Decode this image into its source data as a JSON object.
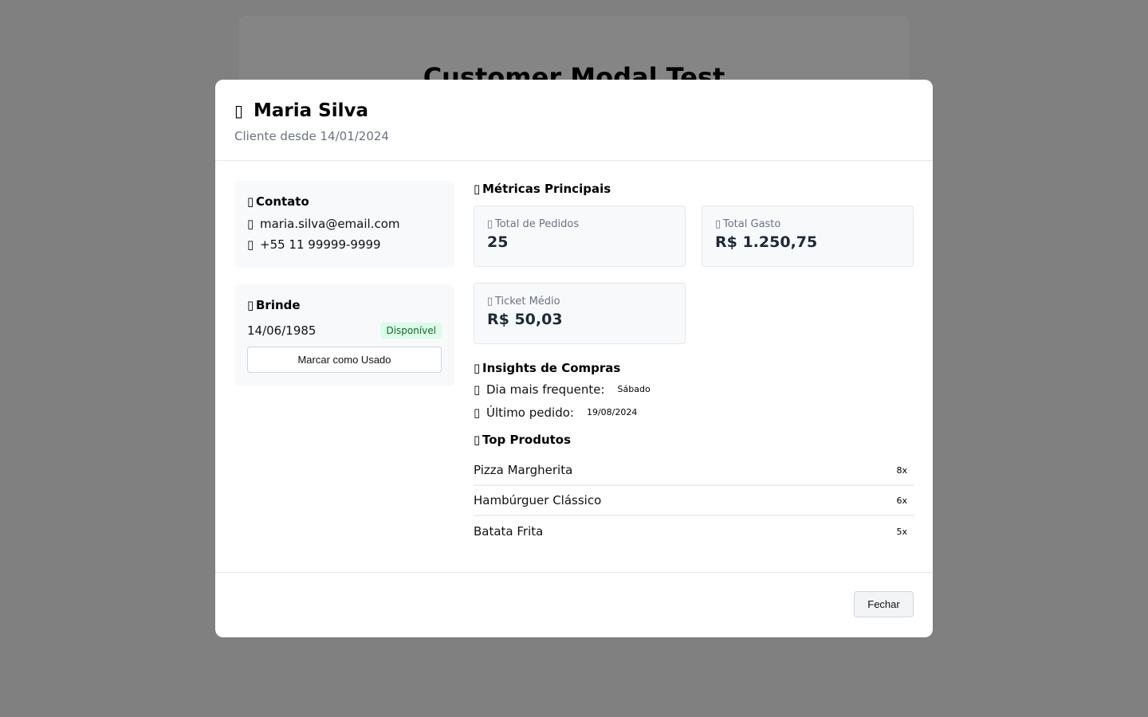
{
  "background": {
    "title": "Customer Modal Test"
  },
  "modal": {
    "customer_icon": "user-icon",
    "customer_name": "Maria Silva",
    "customer_since": "Cliente desde 14/01/2024",
    "contact": {
      "title": "Contato",
      "email": "maria.silva@email.com",
      "phone": "+55 11 99999-9999"
    },
    "gift": {
      "title": "Brinde",
      "date": "14/06/1985",
      "status": "Disponível",
      "mark_used_label": "Marcar como Usado"
    },
    "metrics": {
      "title": "Métricas Principais",
      "total_orders_label": "Total de Pedidos",
      "total_orders_value": "25",
      "total_spent_label": "Total Gasto",
      "total_spent_value": "R$ 1.250,75",
      "avg_ticket_label": "Ticket Médio",
      "avg_ticket_value": "R$ 50,03"
    },
    "insights": {
      "title": "Insights de Compras",
      "frequent_day_label": "Dia mais frequente:",
      "frequent_day_value": "Sábado",
      "last_order_label": "Último pedido:",
      "last_order_value": "19/08/2024"
    },
    "top_products": {
      "title": "Top Produtos",
      "items": [
        {
          "name": "Pizza Margherita",
          "count": "8x"
        },
        {
          "name": "Hambúrguer Clássico",
          "count": "6x"
        },
        {
          "name": "Batata Frita",
          "count": "5x"
        }
      ]
    },
    "close_label": "Fechar"
  },
  "colors": {
    "overlay": "#808080",
    "badge_bg": "#dcfce7",
    "badge_text": "#166534",
    "panel_bg": "#f8f9fb"
  }
}
